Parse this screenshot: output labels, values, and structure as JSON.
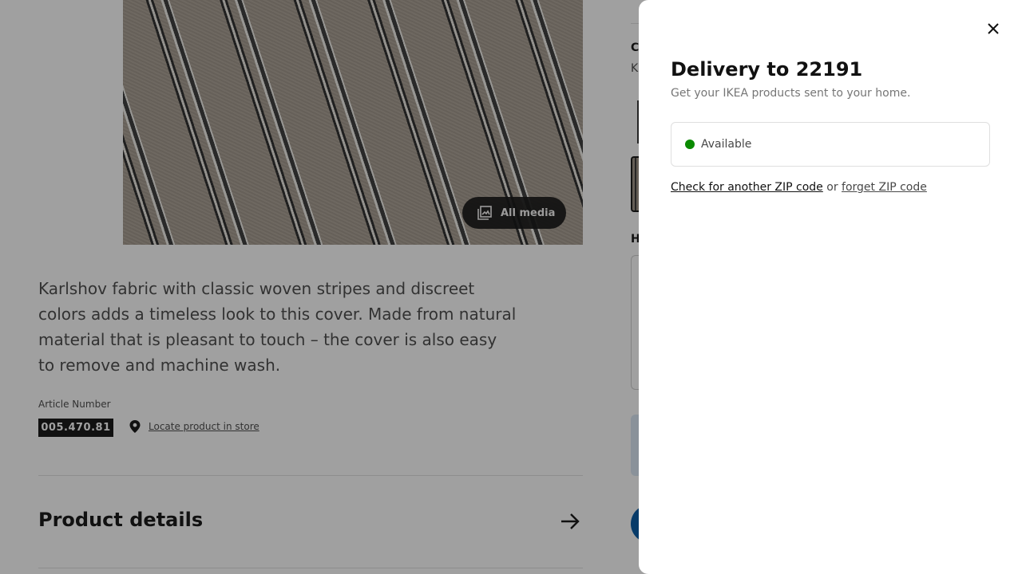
{
  "product": {
    "media_button_label": "All media",
    "description": "Karlshov fabric with classic woven stripes and discreet colors adds a timeless look to this cover. Made from natural material that is pleasant to touch – the cover is also easy to remove and machine wash.",
    "article_label": "Article Number",
    "article_number": "005.470.81",
    "locate_link": "Locate product in store",
    "details_title": "Product details"
  },
  "right_column": {
    "color_heading_initial": "C",
    "color_value_initial": "K",
    "height_heading_initial": "H"
  },
  "modal": {
    "title": "Delivery to 22191",
    "subtitle": "Get your IKEA products sent to your home.",
    "status": "Available",
    "check_link": "Check for another ZIP code",
    "or_text": "or",
    "forget_link": "forget ZIP code"
  },
  "colors": {
    "available_dot": "#0a8a00",
    "brand_blue": "#0058a3",
    "overlay": "rgba(17,17,17,0.4)"
  },
  "icons": {
    "media": "image-gallery-icon",
    "locate": "location-pin-icon",
    "details": "arrow-right-icon",
    "close": "close-icon"
  }
}
